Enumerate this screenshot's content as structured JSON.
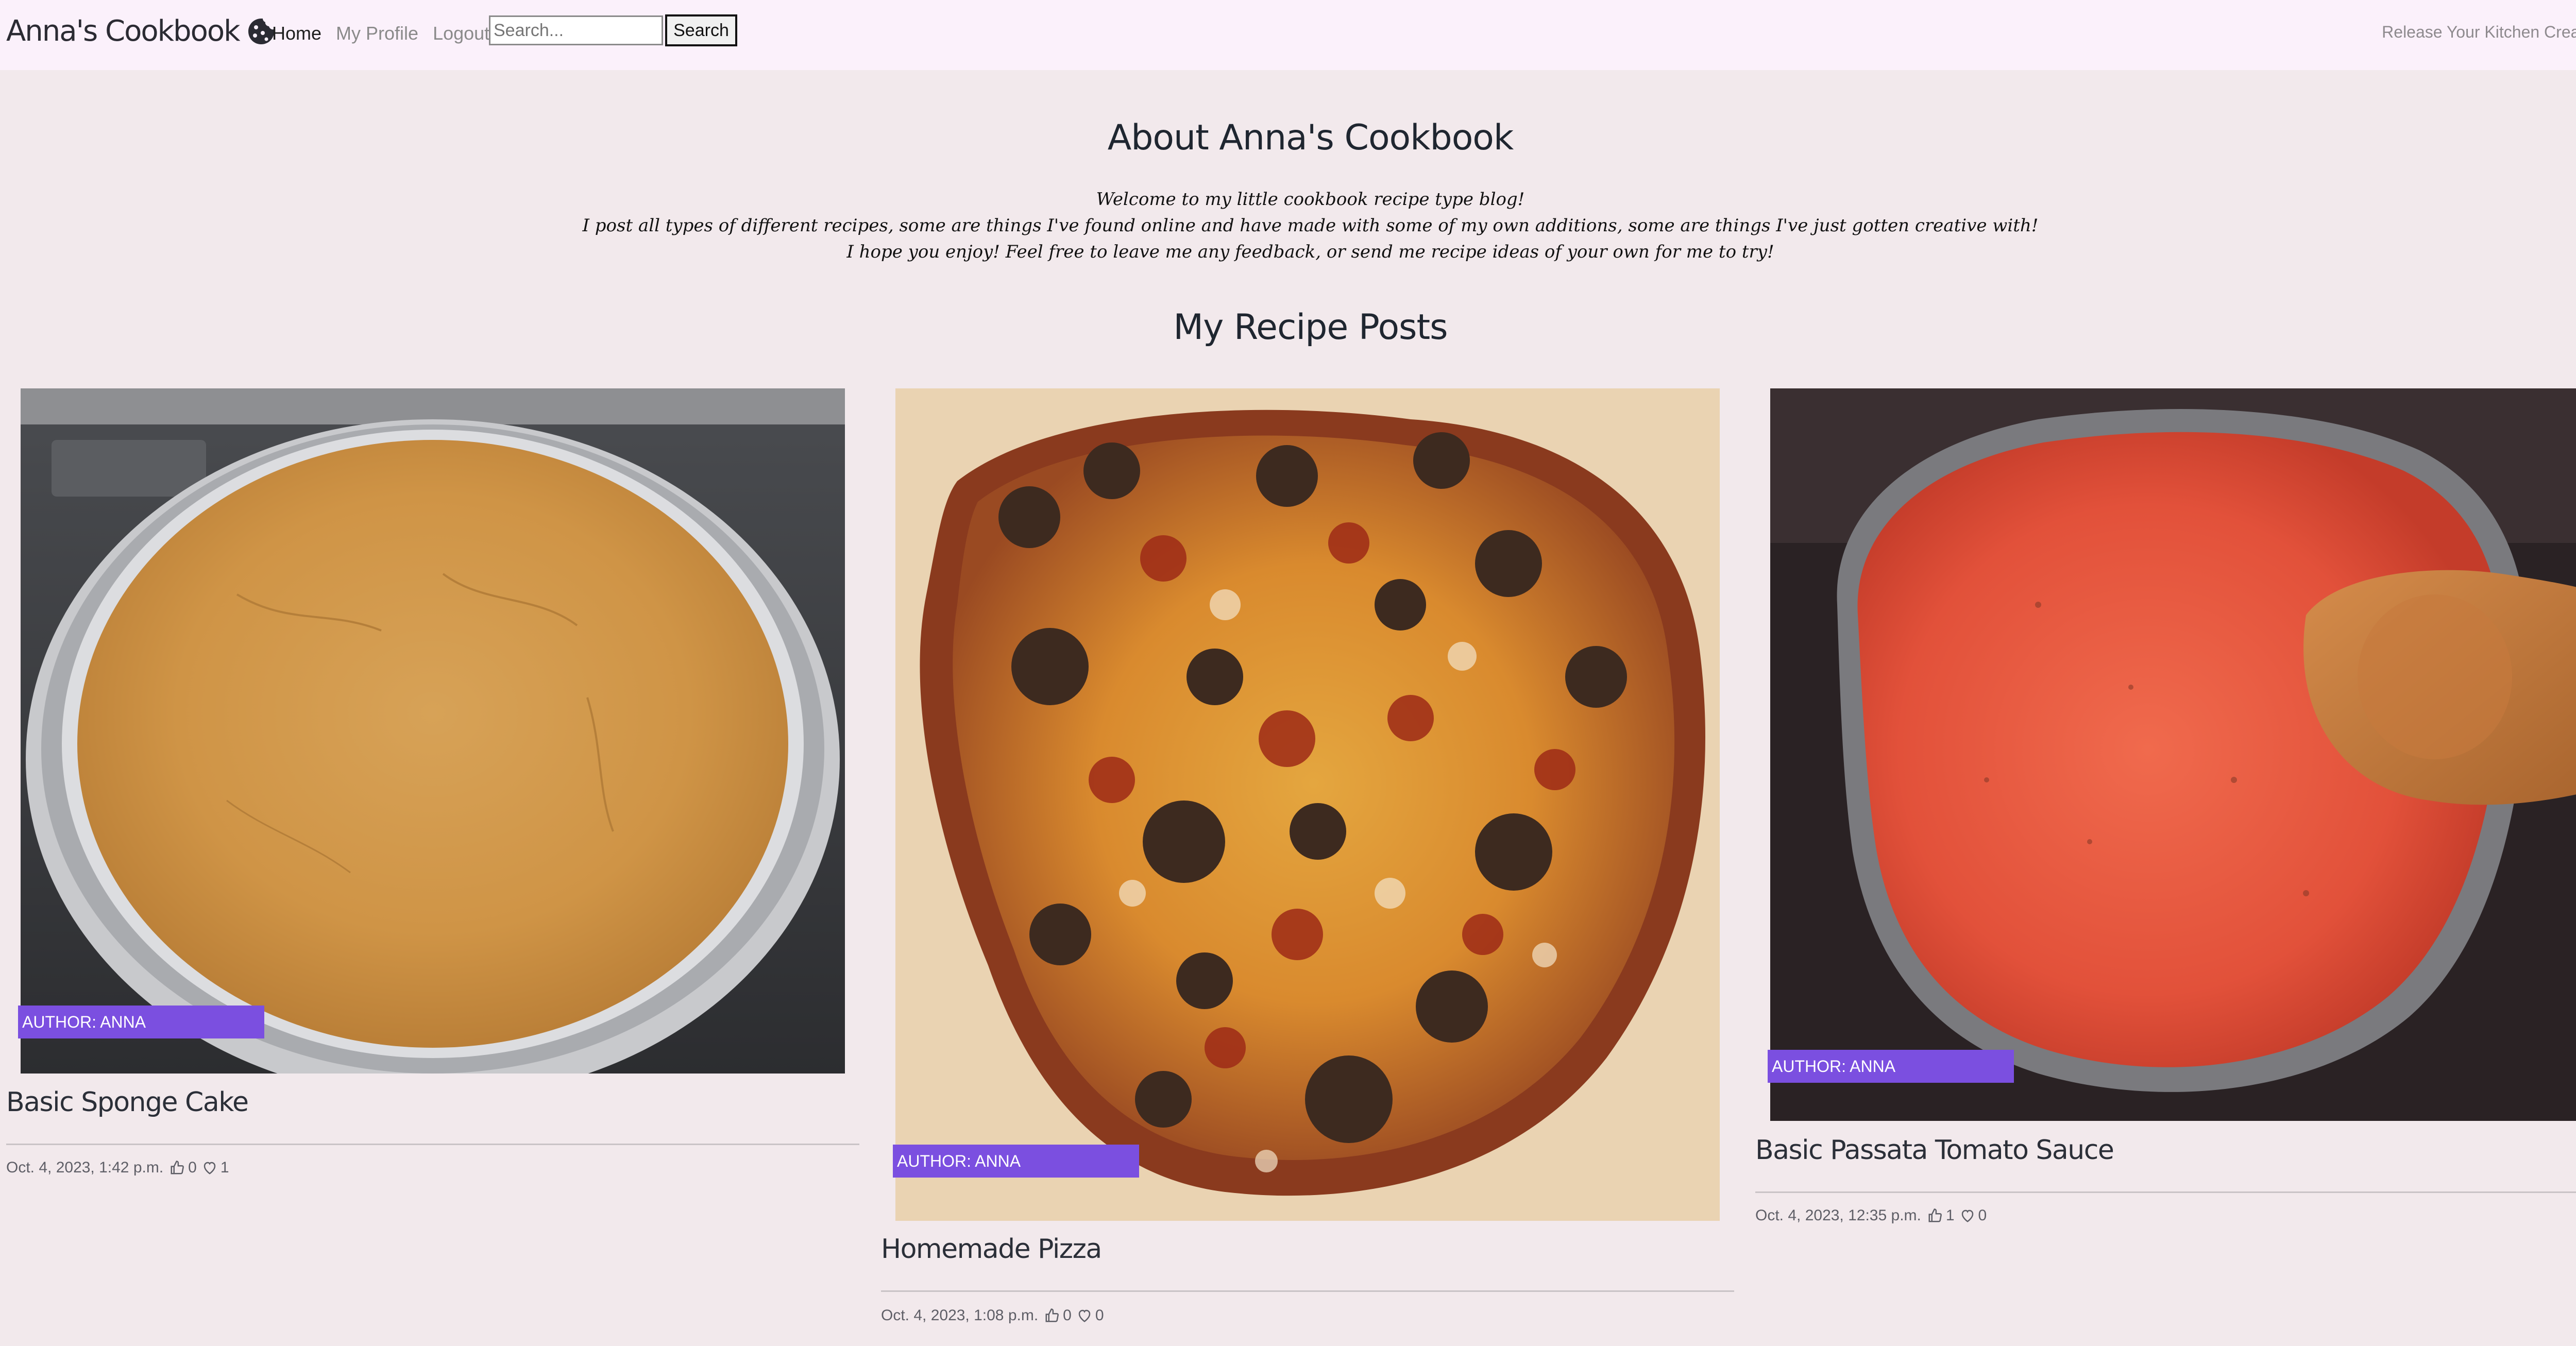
{
  "navbar": {
    "brand": "Anna's Cookbook",
    "brand_icon": "cookie-icon",
    "links": [
      {
        "label": "Home",
        "active": true
      },
      {
        "label": "My Profile",
        "active": false
      },
      {
        "label": "Logout",
        "active": false
      }
    ],
    "search": {
      "placeholder": "Search...",
      "button_label": "Search"
    },
    "tagline": "Release Your Kitchen Creations"
  },
  "about": {
    "title": "About Anna's Cookbook",
    "lines": [
      "Welcome to my little cookbook recipe type blog!",
      "I post all types of different recipes, some are things I've found online and have made with some of my own additions, some are things I've just gotten creative with!",
      "I hope you enjoy! Feel free to leave me any feedback, or send me recipe ideas of your own for me to try!"
    ]
  },
  "recipes": {
    "title": "My Recipe Posts",
    "posts": [
      {
        "image": "cake-photo",
        "author_badge": "AUTHOR: ANNA",
        "title": "Basic Sponge Cake",
        "date": "Oct. 4, 2023, 1:42 p.m.",
        "likes": "0",
        "favourites": "1"
      },
      {
        "image": "pizza-photo",
        "author_badge": "AUTHOR: ANNA",
        "title": "Homemade Pizza",
        "date": "Oct. 4, 2023, 1:08 p.m.",
        "likes": "0",
        "favourites": "0"
      },
      {
        "image": "tomato-sauce-photo",
        "author_badge": "AUTHOR: ANNA",
        "title": "Basic Passata Tomato Sauce",
        "date": "Oct. 4, 2023, 12:35 p.m.",
        "likes": "1",
        "favourites": "0"
      }
    ]
  },
  "colors": {
    "page_bg": "#f2e9ec",
    "navbar_bg": "#fbf1fb",
    "author_badge_bg": "#7b4fe0"
  }
}
